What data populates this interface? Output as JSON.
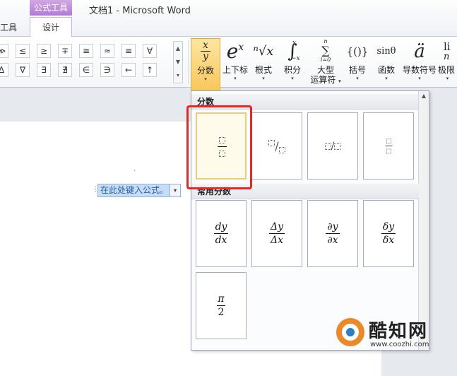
{
  "titlebar": {
    "context_group": "公式工具",
    "window_title": "文档1 - Microsoft Word"
  },
  "tabs": {
    "tools_partial": "工具",
    "design": "设计"
  },
  "ribbon": {
    "symbols_row1": [
      "≫",
      "≤",
      "≥",
      "∓",
      "≅",
      "≈",
      "≡",
      "∀"
    ],
    "symbols_row2": [
      "Δ",
      "∇",
      "∃",
      "∄",
      "∈",
      "∋",
      "←",
      "↑"
    ],
    "structures": [
      {
        "id": "fraction",
        "glyph_top": "x",
        "glyph_bottom": "y",
        "label": "分数",
        "dropdown": "▾"
      },
      {
        "id": "script",
        "glyph_base": "e",
        "glyph_sup": "x",
        "label": "上下标",
        "dropdown": "▾"
      },
      {
        "id": "radical",
        "glyph": "ⁿ√x",
        "label": "根式",
        "dropdown": "▾"
      },
      {
        "id": "integral",
        "glyph": "∫",
        "glyph_sup": "x",
        "glyph_sub": "−x",
        "label": "积分",
        "dropdown": "▾"
      },
      {
        "id": "large-operator",
        "glyph": "∑",
        "glyph_sup": "n",
        "glyph_sub": "i=0",
        "label_line1": "大型",
        "label_line2": "运算符",
        "dropdown": "▾"
      },
      {
        "id": "bracket",
        "glyph": "{()}",
        "label": "括号",
        "dropdown": "▾"
      },
      {
        "id": "function",
        "glyph": "sinθ",
        "label": "函数",
        "dropdown": "▾"
      },
      {
        "id": "accent",
        "glyph": "ä",
        "label": "导数符号",
        "dropdown": "▾"
      },
      {
        "id": "limit",
        "glyph": "li",
        "glyph_sub": "n",
        "label": "极限",
        "dropdown": "▾"
      }
    ]
  },
  "document": {
    "cursor_mark": "⸼",
    "equation_placeholder": "在此处键入公式。",
    "equation_dropdown": "▾"
  },
  "gallery": {
    "section1": "分数",
    "section2": "常用分数",
    "fraction_tiles": [
      {
        "id": "stacked",
        "style": "stacked"
      },
      {
        "id": "skewed",
        "style": "skewed",
        "slash": "/"
      },
      {
        "id": "linear",
        "style": "linear",
        "slash": "/"
      },
      {
        "id": "small",
        "style": "small"
      }
    ],
    "common_tiles": [
      {
        "id": "dy-dx",
        "num": "dy",
        "den": "dx"
      },
      {
        "id": "delta-y-delta-x",
        "num": "Δy",
        "den": "Δx"
      },
      {
        "id": "partial-y-partial-x",
        "num": "∂y",
        "den": "∂x"
      },
      {
        "id": "small-delta-y-delta-x",
        "num": "δy",
        "den": "δx"
      },
      {
        "id": "pi-over-2",
        "num": "π",
        "den": "2"
      }
    ],
    "scroll_up": "▲"
  },
  "watermark": {
    "name": "酷知网",
    "url": "www.coozhi.com"
  }
}
